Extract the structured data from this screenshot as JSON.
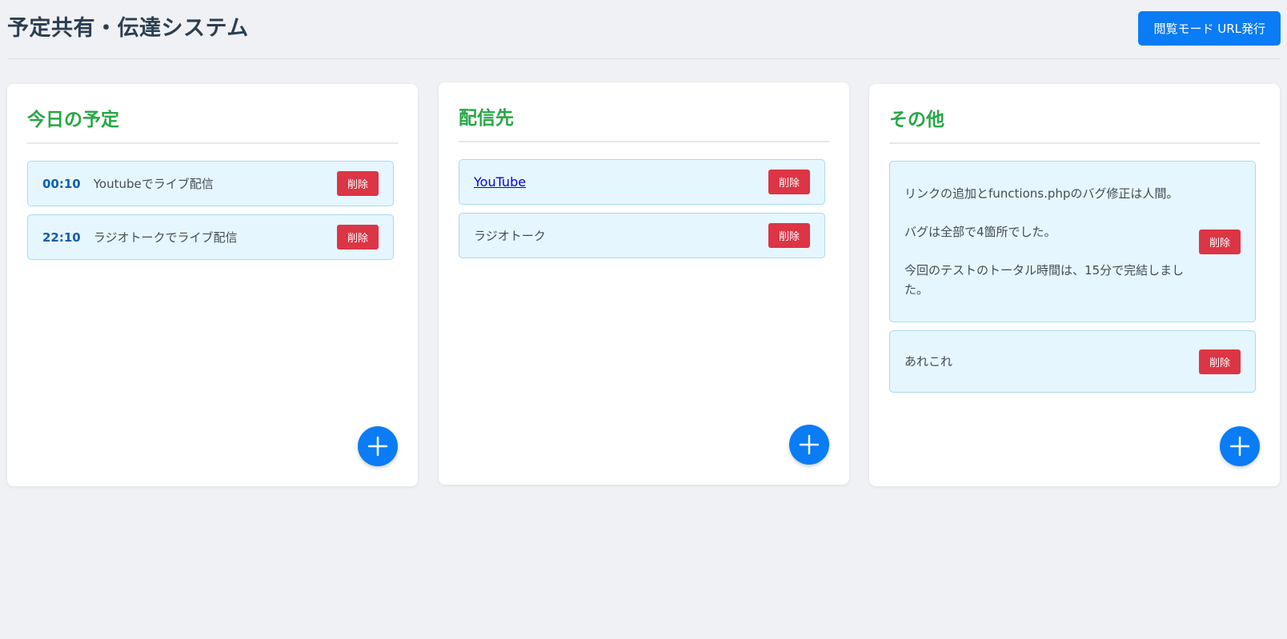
{
  "header": {
    "title": "予定共有・伝達システム",
    "url_button_label": "閲覧モード URL発行"
  },
  "columns": {
    "schedule": {
      "title": "今日の予定",
      "items": [
        {
          "time": "00:10",
          "text": "Youtubeでライブ配信",
          "delete_label": "削除"
        },
        {
          "time": "22:10",
          "text": "ラジオトークでライブ配信",
          "delete_label": "削除"
        }
      ],
      "add_icon": "plus-icon"
    },
    "destinations": {
      "title": "配信先",
      "items": [
        {
          "text": "YouTube",
          "is_link": true,
          "delete_label": "削除"
        },
        {
          "text": "ラジオトーク",
          "is_link": false,
          "delete_label": "削除"
        }
      ],
      "add_icon": "plus-icon"
    },
    "others": {
      "title": "その他",
      "items": [
        {
          "paragraphs": [
            "リンクの追加とfunctions.phpのバグ修正は人間。",
            "バグは全部で4箇所でした。",
            "今回のテストのトータル時間は、15分で完結しました。"
          ],
          "delete_label": "削除"
        },
        {
          "paragraphs": [
            "あれこれ"
          ],
          "delete_label": "削除"
        }
      ],
      "add_icon": "plus-icon"
    }
  },
  "colors": {
    "background": "#eff1f5",
    "primary": "#0a7cf5",
    "accent_green": "#28a745",
    "danger": "#dc3545",
    "item_background": "#e6f6fe",
    "time_text": "#0d5eaf"
  }
}
